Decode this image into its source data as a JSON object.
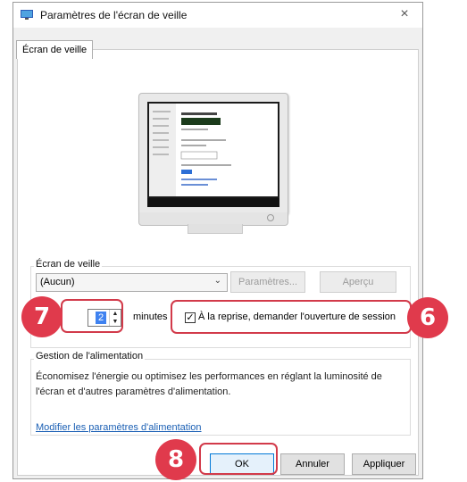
{
  "window": {
    "title": "Paramètres de l'écran de veille",
    "close_glyph": "×"
  },
  "tabs": [
    {
      "label": "Écran de veille"
    }
  ],
  "screensaver": {
    "group_label": "Écran de veille",
    "selected": "(Aucun)",
    "settings_label": "Paramètres...",
    "preview_label": "Aperçu"
  },
  "wait": {
    "value": "2",
    "unit_label": "minutes",
    "resume_label": "À la reprise, demander l'ouverture de session",
    "resume_checked": true
  },
  "power": {
    "group_label": "Gestion de l'alimentation",
    "description": "Économisez l'énergie ou optimisez les performances en réglant la luminosité de l'écran et d'autres paramètres d'alimentation.",
    "link_label": "Modifier les paramètres d'alimentation"
  },
  "footer": {
    "ok_label": "OK",
    "cancel_label": "Annuler",
    "apply_label": "Appliquer"
  },
  "callouts": {
    "c7": "7",
    "c6": "6",
    "c8": "8"
  },
  "colors": {
    "callout": "#e03a4c",
    "highlight": "#d23a4a",
    "link": "#1a5fb4",
    "selection": "#3f82f0"
  }
}
